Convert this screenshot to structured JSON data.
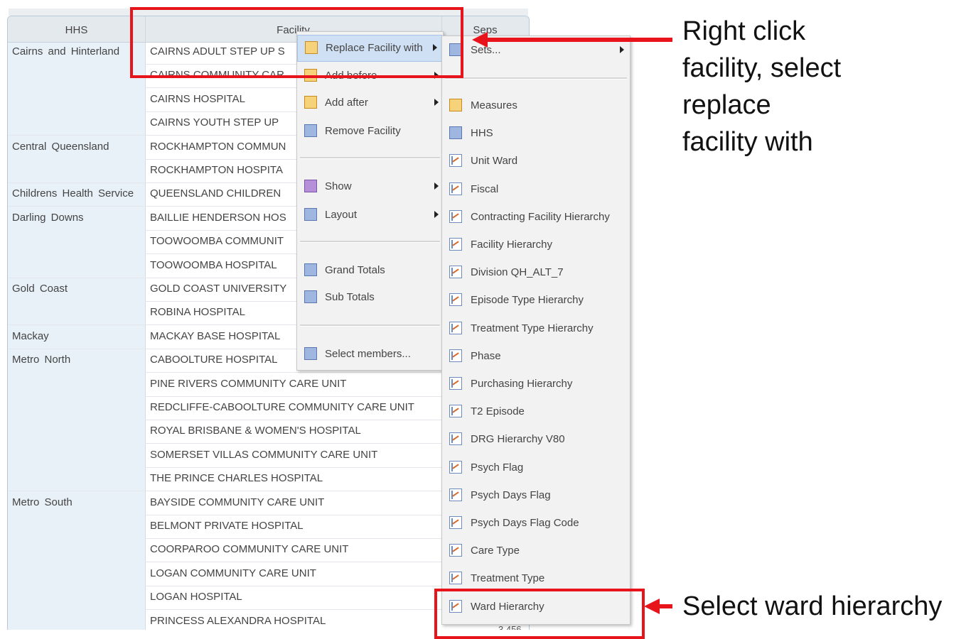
{
  "table": {
    "headers": {
      "hhs": "HHS",
      "facility": "Facility",
      "seps": "Seps"
    },
    "rows": [
      {
        "hhs": "Cairns and Hinterland",
        "facility": "CAIRNS ADULT STEP UP S"
      },
      {
        "hhs": "",
        "facility": "CAIRNS COMMUNITY CAR"
      },
      {
        "hhs": "",
        "facility": "CAIRNS HOSPITAL"
      },
      {
        "hhs": "",
        "facility": "CAIRNS YOUTH STEP UP"
      },
      {
        "hhs": "Central Queensland",
        "facility": "ROCKHAMPTON COMMUN"
      },
      {
        "hhs": "",
        "facility": "ROCKHAMPTON HOSPITA"
      },
      {
        "hhs": "Childrens Health Service",
        "facility": "QUEENSLAND CHILDREN"
      },
      {
        "hhs": "Darling Downs",
        "facility": "BAILLIE HENDERSON HOS"
      },
      {
        "hhs": "",
        "facility": "TOOWOOMBA COMMUNIT"
      },
      {
        "hhs": "",
        "facility": "TOOWOOMBA HOSPITAL"
      },
      {
        "hhs": "Gold Coast",
        "facility": "GOLD COAST UNIVERSITY"
      },
      {
        "hhs": "",
        "facility": "ROBINA HOSPITAL"
      },
      {
        "hhs": "Mackay",
        "facility": "MACKAY BASE HOSPITAL"
      },
      {
        "hhs": "Metro North",
        "facility": "CABOOLTURE HOSPITAL"
      },
      {
        "hhs": "",
        "facility": "PINE RIVERS COMMUNITY CARE UNIT"
      },
      {
        "hhs": "",
        "facility": "REDCLIFFE-CABOOLTURE COMMUNITY CARE UNIT"
      },
      {
        "hhs": "",
        "facility": "ROYAL BRISBANE & WOMEN'S HOSPITAL"
      },
      {
        "hhs": "",
        "facility": "SOMERSET VILLAS COMMUNITY CARE UNIT"
      },
      {
        "hhs": "",
        "facility": "THE PRINCE CHARLES HOSPITAL"
      },
      {
        "hhs": "Metro South",
        "facility": "BAYSIDE COMMUNITY CARE UNIT"
      },
      {
        "hhs": "",
        "facility": "BELMONT PRIVATE HOSPITAL"
      },
      {
        "hhs": "",
        "facility": "COORPAROO COMMUNITY CARE UNIT"
      },
      {
        "hhs": "",
        "facility": "LOGAN COMMUNITY CARE UNIT"
      },
      {
        "hhs": "",
        "facility": "LOGAN HOSPITAL"
      },
      {
        "hhs": "",
        "facility": "PRINCESS ALEXANDRA HOSPITAL"
      }
    ],
    "last_seps": "3,456"
  },
  "context_menu": {
    "items": [
      {
        "label": "Replace Facility with",
        "icon": "replace-icon",
        "submenu": true,
        "highlighted": true
      },
      {
        "label": "Add before",
        "icon": "add-before-icon",
        "submenu": true
      },
      {
        "label": "Add after",
        "icon": "add-after-icon",
        "submenu": true
      },
      {
        "label": "Remove Facility",
        "icon": "remove-icon",
        "submenu": false
      },
      {
        "label": "Show",
        "icon": "show-icon",
        "submenu": true
      },
      {
        "label": "Layout",
        "icon": "layout-icon",
        "submenu": true
      },
      {
        "label": "Grand Totals",
        "icon": "grand-totals-icon",
        "submenu": false
      },
      {
        "label": "Sub Totals",
        "icon": "sub-totals-icon",
        "submenu": false
      },
      {
        "label": "Select members...",
        "icon": "select-members-icon",
        "submenu": false
      }
    ]
  },
  "submenu": {
    "items": [
      {
        "label": "Sets...",
        "icon": "sets-icon",
        "submenu": true
      },
      {
        "label": "Measures",
        "icon": "measures-icon"
      },
      {
        "label": "HHS",
        "icon": "dimension-icon"
      },
      {
        "label": "Unit Ward",
        "icon": "hierarchy-icon"
      },
      {
        "label": "Fiscal",
        "icon": "hierarchy-icon"
      },
      {
        "label": "Contracting Facility Hierarchy",
        "icon": "hierarchy-icon"
      },
      {
        "label": "Facility Hierarchy",
        "icon": "hierarchy-icon"
      },
      {
        "label": "Division QH_ALT_7",
        "icon": "hierarchy-icon"
      },
      {
        "label": "Episode Type Hierarchy",
        "icon": "hierarchy-icon"
      },
      {
        "label": "Treatment Type Hierarchy",
        "icon": "hierarchy-icon"
      },
      {
        "label": "Phase",
        "icon": "hierarchy-icon"
      },
      {
        "label": "Purchasing Hierarchy",
        "icon": "hierarchy-icon"
      },
      {
        "label": "T2 Episode",
        "icon": "hierarchy-icon"
      },
      {
        "label": "DRG Hierarchy V80",
        "icon": "hierarchy-icon"
      },
      {
        "label": "Psych Flag",
        "icon": "hierarchy-icon"
      },
      {
        "label": "Psych Days Flag",
        "icon": "hierarchy-icon"
      },
      {
        "label": "Psych Days Flag Code",
        "icon": "hierarchy-icon"
      },
      {
        "label": "Care Type",
        "icon": "hierarchy-icon"
      },
      {
        "label": "Treatment Type",
        "icon": "hierarchy-icon"
      },
      {
        "label": "Ward Hierarchy",
        "icon": "hierarchy-icon"
      }
    ]
  },
  "annotations": {
    "top": [
      "Right click",
      "facility, select",
      "replace",
      "facility with"
    ],
    "bottom": "Select ward hierarchy",
    "color": "#e8141c"
  }
}
